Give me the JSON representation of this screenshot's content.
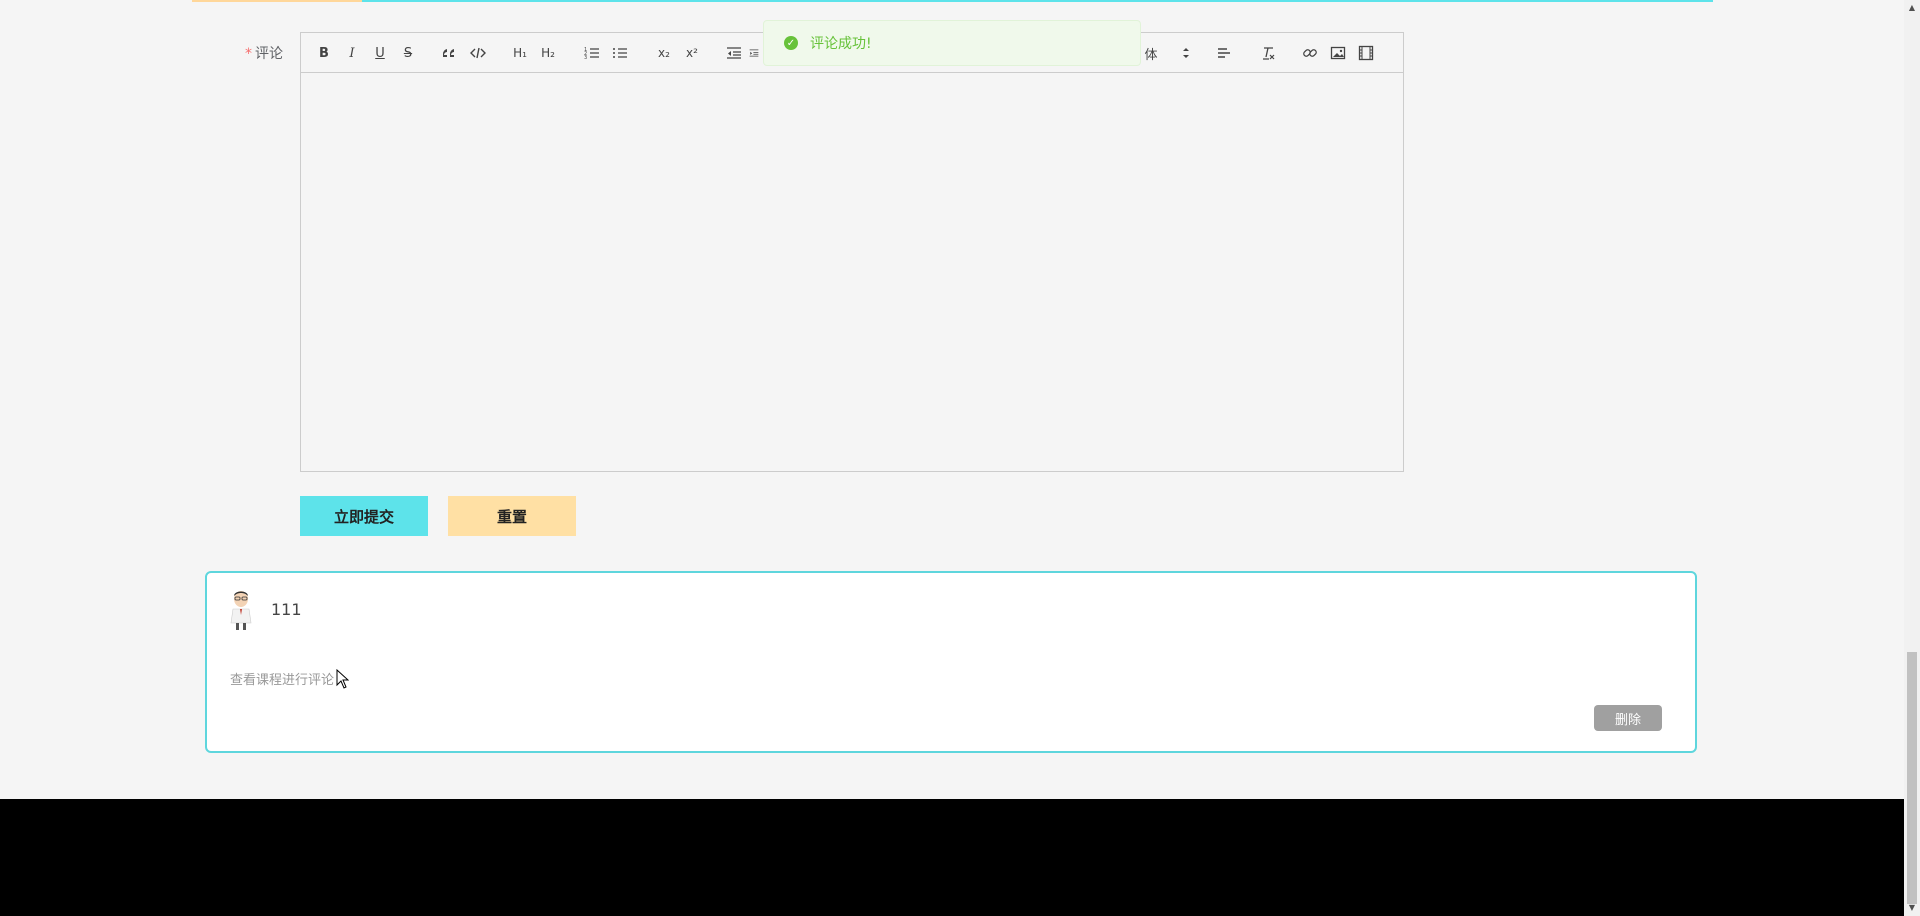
{
  "form": {
    "label": "评论",
    "required_mark": "*"
  },
  "toolbar": {
    "bold": "B",
    "italic": "I",
    "underline": "U",
    "strike": "S",
    "h1": "H₁",
    "h2": "H₂",
    "subscript": "x₂",
    "superscript": "x²",
    "font_label": "体"
  },
  "toast": {
    "message": "评论成功!",
    "color": "#67c23a"
  },
  "buttons": {
    "submit": "立即提交",
    "reset": "重置"
  },
  "comment": {
    "user": "111",
    "text": "查看课程进行评论",
    "delete": "删除"
  },
  "colors": {
    "accent": "#5de3ea",
    "reset": "#ffe0a4",
    "card_border": "#5ed6dd",
    "footer": "#000000"
  }
}
